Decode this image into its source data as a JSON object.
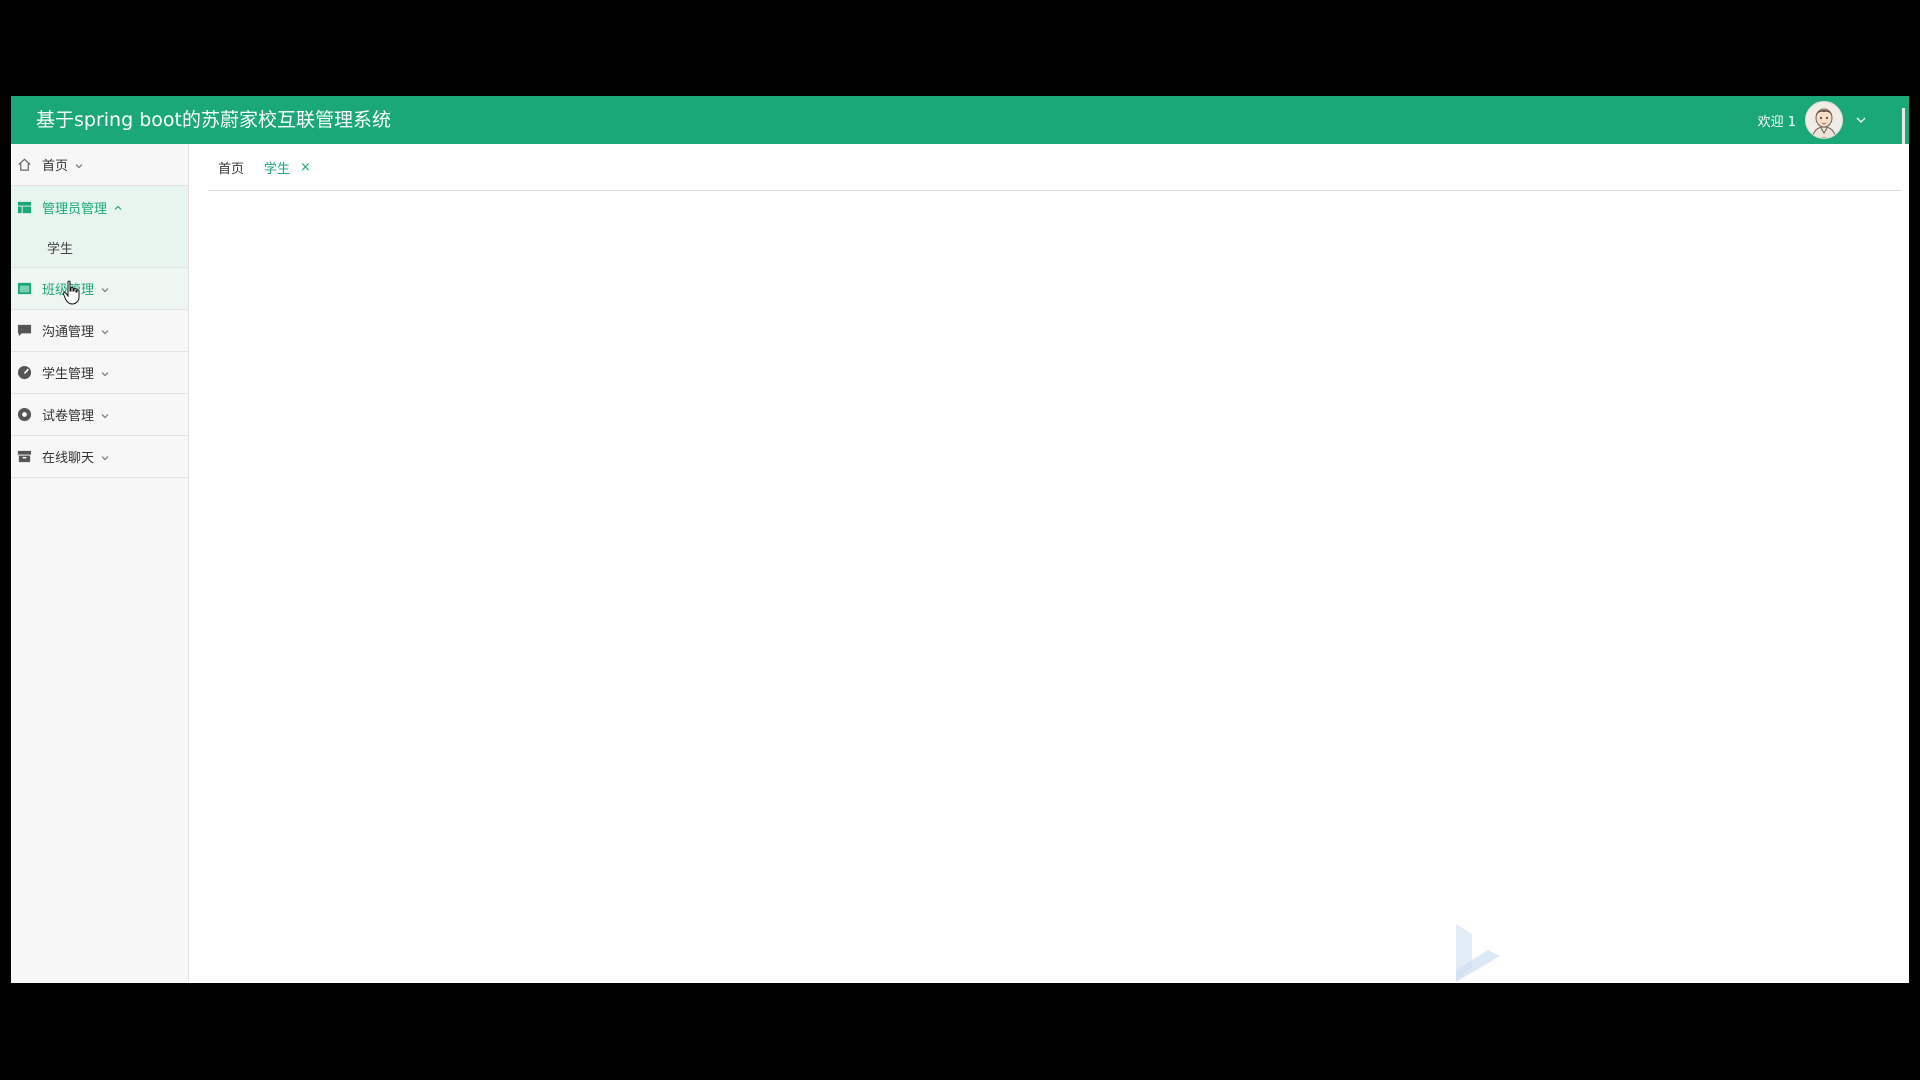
{
  "header": {
    "title": "基于spring boot的苏蔚家校互联管理系统",
    "welcome": "欢迎 1",
    "accent_color": "#1aa878",
    "avatar_icon": "user-avatar-icon",
    "menu_icon": "chevron-down-icon"
  },
  "sidebar": {
    "items": [
      {
        "label": "首页",
        "icon": "home-icon",
        "expanded": false
      },
      {
        "label": "管理员管理",
        "icon": "layout-icon",
        "expanded": true,
        "children": [
          {
            "label": "学生"
          }
        ]
      },
      {
        "label": "班级管理",
        "icon": "folder-icon",
        "expanded": false
      },
      {
        "label": "沟通管理",
        "icon": "comment-icon",
        "expanded": false
      },
      {
        "label": "学生管理",
        "icon": "dashboard-icon",
        "expanded": false
      },
      {
        "label": "试卷管理",
        "icon": "record-icon",
        "expanded": false
      },
      {
        "label": "在线聊天",
        "icon": "archive-icon",
        "expanded": false
      }
    ]
  },
  "tabs": [
    {
      "label": "首页",
      "active": false
    },
    {
      "label": "学生",
      "active": true,
      "close": "×"
    }
  ]
}
